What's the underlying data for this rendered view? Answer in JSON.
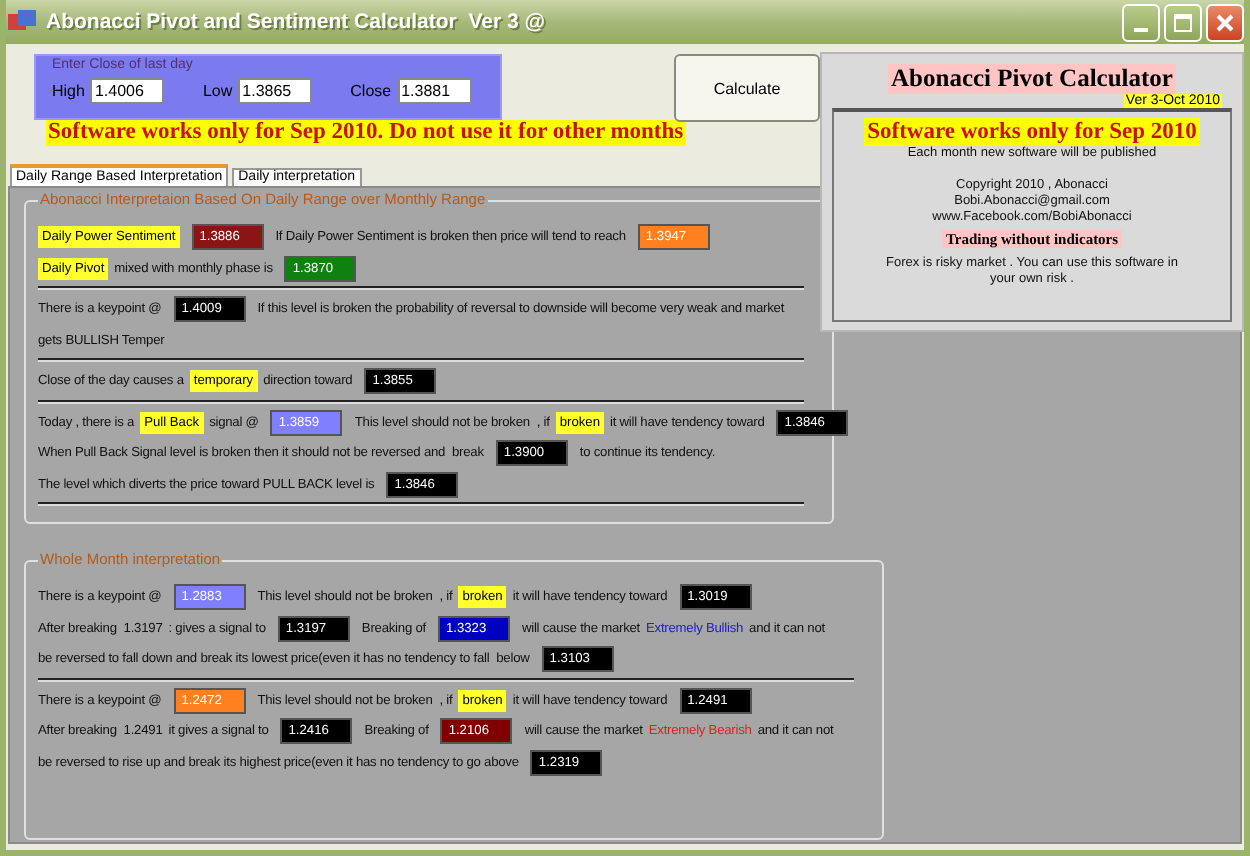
{
  "window": {
    "title": "Abonacci Pivot and Sentiment Calculator  Ver 3 @"
  },
  "input_group": {
    "legend": "Enter Close of last day",
    "fields": [
      {
        "label": "High",
        "value": "1.4006"
      },
      {
        "label": "Low",
        "value": "1.3865"
      },
      {
        "label": "Close",
        "value": "1.3881"
      }
    ]
  },
  "calculate_button": "Calculate",
  "warning_banner": "Software works only for Sep 2010. Do not use it for other months",
  "tabs": [
    {
      "label": "Daily Range Based Interpretation",
      "selected": true
    },
    {
      "label": "Daily interpretation",
      "selected": false
    }
  ],
  "groups": [
    {
      "legend": "Abonacci Interpretaion Based On Daily Range over Monthly Range",
      "blocks": [
        {
          "rule_after": true,
          "lines": [
            {
              "segments": [
                {
                  "kind": "tag",
                  "text": "Daily Power Sentiment"
                },
                {
                  "kind": "value",
                  "text": "1.3886",
                  "color": "#8b1414"
                },
                {
                  "kind": "text",
                  "text": "If Daily Power Sentiment is broken then price will tend to reach"
                },
                {
                  "kind": "value",
                  "text": "1.3947",
                  "color": "#ff8020"
                }
              ]
            },
            {
              "segments": [
                {
                  "kind": "tag",
                  "text": "Daily Pivot"
                },
                {
                  "kind": "text",
                  "text": "mixed with monthly phase is"
                },
                {
                  "kind": "value",
                  "text": "1.3870",
                  "color": "#108010"
                }
              ]
            }
          ]
        },
        {
          "rule_after": true,
          "lines": [
            {
              "segments": [
                {
                  "kind": "text",
                  "text": "There is a keypoint @"
                },
                {
                  "kind": "value",
                  "text": "1.4009",
                  "color": "#000000"
                },
                {
                  "kind": "text",
                  "text": "If this level is broken the probability of reversal to downside will become very weak and market"
                }
              ]
            },
            {
              "segments": [
                {
                  "kind": "text",
                  "text": "gets BULLISH Temper"
                }
              ]
            }
          ]
        },
        {
          "rule_after": true,
          "lines": [
            {
              "segments": [
                {
                  "kind": "text",
                  "text": "Close of the day causes a"
                },
                {
                  "kind": "tag",
                  "text": "temporary"
                },
                {
                  "kind": "text",
                  "text": "direction toward"
                },
                {
                  "kind": "value",
                  "text": "1.3855",
                  "color": "#000000"
                }
              ]
            }
          ]
        },
        {
          "rule_after": true,
          "lines": [
            {
              "segments": [
                {
                  "kind": "text",
                  "text": "Today , there is a"
                },
                {
                  "kind": "tag",
                  "text": "Pull Back"
                },
                {
                  "kind": "text",
                  "text": "signal @"
                },
                {
                  "kind": "value",
                  "text": "1.3859",
                  "color": "#8080ff"
                },
                {
                  "kind": "text",
                  "text": "This level should not be broken  , if"
                },
                {
                  "kind": "tag",
                  "text": "broken"
                },
                {
                  "kind": "text",
                  "text": "it will have tendency toward"
                },
                {
                  "kind": "value",
                  "text": "1.3846",
                  "color": "#000000"
                }
              ]
            },
            {
              "segments": [
                {
                  "kind": "text",
                  "text": "When Pull Back Signal level is broken then it should not be reversed and  break"
                },
                {
                  "kind": "value",
                  "text": "1.3900",
                  "color": "#000000"
                },
                {
                  "kind": "text",
                  "text": "to continue its tendency."
                }
              ]
            },
            {
              "segments": [
                {
                  "kind": "text",
                  "text": "The level which diverts the price toward PULL BACK level is"
                },
                {
                  "kind": "value",
                  "text": "1.3846",
                  "color": "#000000"
                }
              ]
            }
          ]
        }
      ]
    },
    {
      "legend": "Whole Month interpretation",
      "blocks": [
        {
          "rule_after": true,
          "lines": [
            {
              "segments": [
                {
                  "kind": "text",
                  "text": "There is a keypoint @"
                },
                {
                  "kind": "value",
                  "text": "1.2883",
                  "color": "#8080ff"
                },
                {
                  "kind": "text",
                  "text": "This level should not be broken  , if"
                },
                {
                  "kind": "tag",
                  "text": "broken"
                },
                {
                  "kind": "text",
                  "text": "it will have tendency toward"
                },
                {
                  "kind": "value",
                  "text": "1.3019",
                  "color": "#000000"
                }
              ]
            },
            {
              "segments": [
                {
                  "kind": "text",
                  "text": "After breaking  1.3197"
                },
                {
                  "kind": "text",
                  "text": ": gives a signal to"
                },
                {
                  "kind": "value",
                  "text": "1.3197",
                  "color": "#000000"
                },
                {
                  "kind": "text",
                  "text": "Breaking of"
                },
                {
                  "kind": "value",
                  "text": "1.3323",
                  "color": "#0000c0"
                },
                {
                  "kind": "text",
                  "text": "will cause the market"
                },
                {
                  "kind": "emphasis",
                  "text": "Extremely Bullish",
                  "color": "#2020c8"
                },
                {
                  "kind": "text",
                  "text": "and it can not"
                }
              ]
            },
            {
              "segments": [
                {
                  "kind": "text",
                  "text": "be reversed to fall down and break its lowest price(even it has no tendency to fall  below"
                },
                {
                  "kind": "value",
                  "text": "1.3103",
                  "color": "#000000"
                }
              ]
            }
          ]
        },
        {
          "rule_after": false,
          "lines": [
            {
              "segments": [
                {
                  "kind": "text",
                  "text": "There is a keypoint @"
                },
                {
                  "kind": "value",
                  "text": "1.2472",
                  "color": "#ff8020"
                },
                {
                  "kind": "text",
                  "text": "This level should not be broken  , if"
                },
                {
                  "kind": "tag",
                  "text": "broken"
                },
                {
                  "kind": "text",
                  "text": "it will have tendency toward"
                },
                {
                  "kind": "value",
                  "text": "1.2491",
                  "color": "#000000"
                }
              ]
            },
            {
              "segments": [
                {
                  "kind": "text",
                  "text": "After breaking  1.2491"
                },
                {
                  "kind": "text",
                  "text": "it gives a signal to"
                },
                {
                  "kind": "value",
                  "text": "1.2416",
                  "color": "#000000"
                },
                {
                  "kind": "text",
                  "text": "Breaking of"
                },
                {
                  "kind": "value",
                  "text": "1.2106",
                  "color": "#800000"
                },
                {
                  "kind": "text",
                  "text": "will cause the market"
                },
                {
                  "kind": "emphasis",
                  "text": "Extremely Bearish",
                  "color": "#e02020"
                },
                {
                  "kind": "text",
                  "text": "and it can not"
                }
              ]
            },
            {
              "segments": [
                {
                  "kind": "text",
                  "text": "be reversed to rise up and break its highest price(even it has no tendency to go above"
                },
                {
                  "kind": "value",
                  "text": "1.2319",
                  "color": "#000000"
                }
              ]
            }
          ]
        }
      ]
    }
  ],
  "info_panel": {
    "title": "Abonacci Pivot Calculator",
    "version": "Ver 3-Oct 2010",
    "banner": "Software works only for Sep 2010",
    "notice": "Each month new software will be published",
    "contacts": [
      "Copyright 2010 , Abonacci",
      "Bobi.Abonacci@gmail.com",
      "www.Facebook.com/BobiAbonacci"
    ],
    "slogan": "Trading without indicators",
    "disclaimer": "Forex is risky market . You can use this software in your own risk ."
  }
}
